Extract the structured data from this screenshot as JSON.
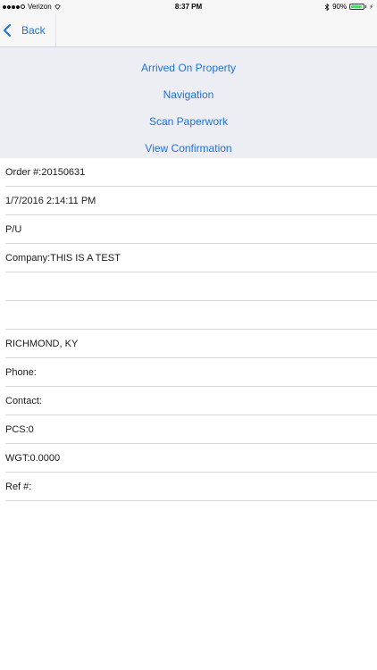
{
  "status_bar": {
    "carrier": "Verizon",
    "time": "8:37 PM",
    "battery": "90%",
    "battery_level": 0.9
  },
  "nav": {
    "back_label": "Back"
  },
  "actions": [
    {
      "label": "Arrived On Property"
    },
    {
      "label": "Navigation"
    },
    {
      "label": "Scan Paperwork"
    },
    {
      "label": "View Confirmation"
    }
  ],
  "details": [
    {
      "text": "Order #:20150631"
    },
    {
      "text": "1/7/2016 2:14:11 PM"
    },
    {
      "text": "P/U"
    },
    {
      "text": "Company:THIS IS A TEST"
    },
    {
      "text": ""
    },
    {
      "text": ""
    },
    {
      "text": "RICHMOND, KY"
    },
    {
      "text": "Phone:"
    },
    {
      "text": "Contact:"
    },
    {
      "text": "PCS:0"
    },
    {
      "text": "WGT:0.0000"
    },
    {
      "text": "Ref #:"
    }
  ],
  "colors": {
    "accent": "#1e73d9",
    "panel_bg": "#eceef3",
    "battery_green": "#4cd964"
  }
}
